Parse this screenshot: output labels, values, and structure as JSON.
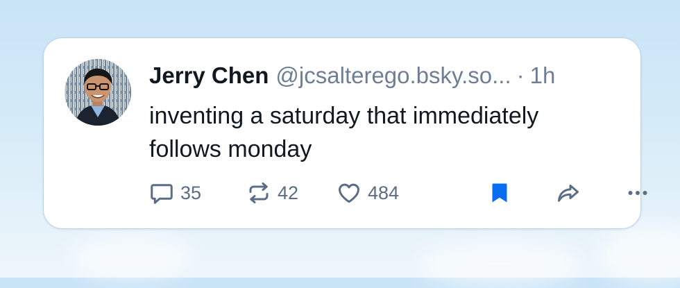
{
  "post": {
    "author_name": "Jerry Chen",
    "handle": "@jcsalterego.bsky.so...",
    "separator": "·",
    "time": "1h",
    "text": "inventing a saturday that immediately follows monday",
    "avatar_alt": "Jerry Chen avatar"
  },
  "actions": {
    "reply": {
      "icon": "reply-icon",
      "count": "35"
    },
    "repost": {
      "icon": "repost-icon",
      "count": "42"
    },
    "like": {
      "icon": "heart-icon",
      "count": "484"
    },
    "bookmark": {
      "icon": "bookmark-icon",
      "active": true
    },
    "share": {
      "icon": "share-icon"
    },
    "more": {
      "icon": "more-icon"
    }
  },
  "colors": {
    "text": "#111820",
    "muted": "#6e7f94",
    "icon": "#5b6d84",
    "accent": "#0a6cf0",
    "card_border": "#b9d4ea"
  }
}
